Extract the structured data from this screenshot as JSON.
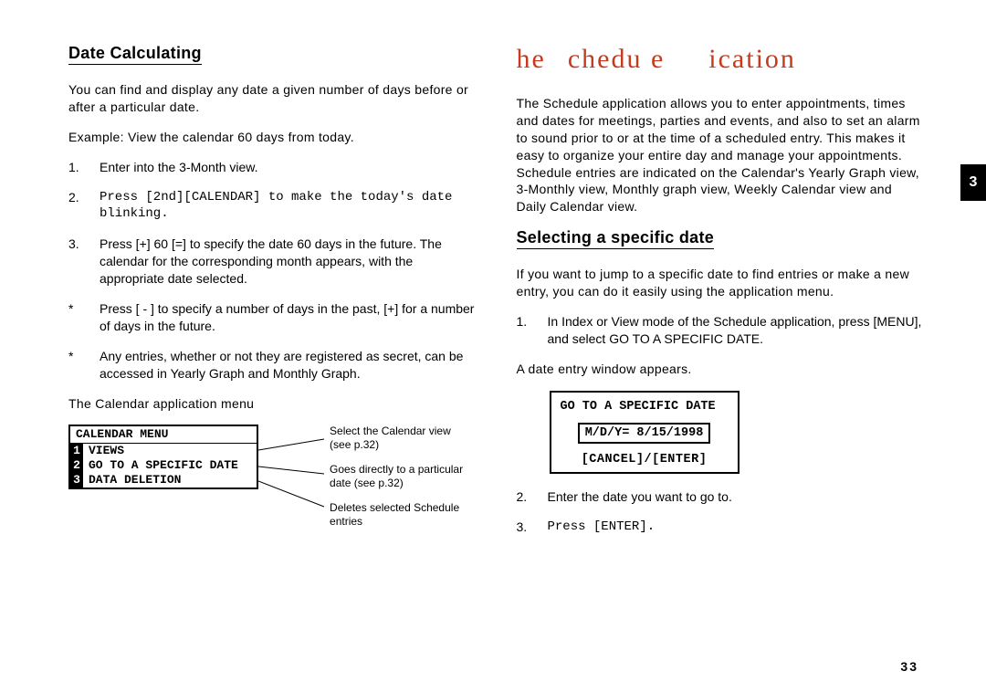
{
  "page_number": "33",
  "chapter_tab": "3",
  "left": {
    "heading": "Date Calculating",
    "intro": "You can find and display any date a given number of days before or after a particular date.",
    "example": "Example: View the calendar 60 days from today.",
    "steps": [
      {
        "n": "1.",
        "text": "Enter into the 3-Month view."
      },
      {
        "n": "2.",
        "text": "Press [2nd][CALENDAR] to make the today's date blinking."
      },
      {
        "n": "3.",
        "text": "Press [+] 60 [=] to specify the date 60 days in the future. The calendar for the corresponding month appears, with the appropriate date selected."
      }
    ],
    "notes": [
      {
        "n": "*",
        "text": "Press [ - ] to specify a number of days in the past, [+] for a number of days in the future."
      },
      {
        "n": "*",
        "text": "Any entries, whether or not they are registered as secret, can be accessed in Yearly Graph and Monthly Graph."
      }
    ],
    "menu_caption": "The Calendar application menu",
    "menu": {
      "title": "CALENDAR MENU",
      "items": [
        {
          "num": "1",
          "label": "VIEWS"
        },
        {
          "num": "2",
          "label": "GO TO A SPECIFIC DATE"
        },
        {
          "num": "3",
          "label": "DATA DELETION"
        }
      ]
    },
    "callouts": [
      "Select the Calendar view (see p.32)",
      "Goes directly to a particular date (see p.32)",
      "Deletes selected Schedule entries"
    ]
  },
  "right": {
    "chapter_title_a": "he",
    "chapter_title_b": "chedu e",
    "chapter_title_c": "ication",
    "intro": "The Schedule application allows you to enter appointments, times and dates for meetings, parties and events, and also to set an alarm to sound prior to or at the time of a scheduled entry. This makes it easy to organize your entire day and manage your appointments. Schedule entries are indicated on the Calendar's Yearly Graph view, 3-Monthly view, Monthly graph view, Weekly Calendar view and Daily Calendar view.",
    "subheading": "Selecting a specific date",
    "sub_intro": "If you want to jump to a specific date to find entries or make a new entry, you can do it easily using the application menu.",
    "steps1": [
      {
        "n": "1.",
        "text": "In Index or View mode of the Schedule application, press [MENU], and select GO TO A SPECIFIC DATE."
      }
    ],
    "appears": "A date entry window appears.",
    "window": {
      "title": "GO TO A SPECIFIC DATE",
      "value": "M/D/Y= 8/15/1998",
      "buttons": "[CANCEL]/[ENTER]"
    },
    "steps2": [
      {
        "n": "2.",
        "text": "Enter the date you want to go to."
      },
      {
        "n": "3.",
        "text": "Press [ENTER]."
      }
    ]
  }
}
